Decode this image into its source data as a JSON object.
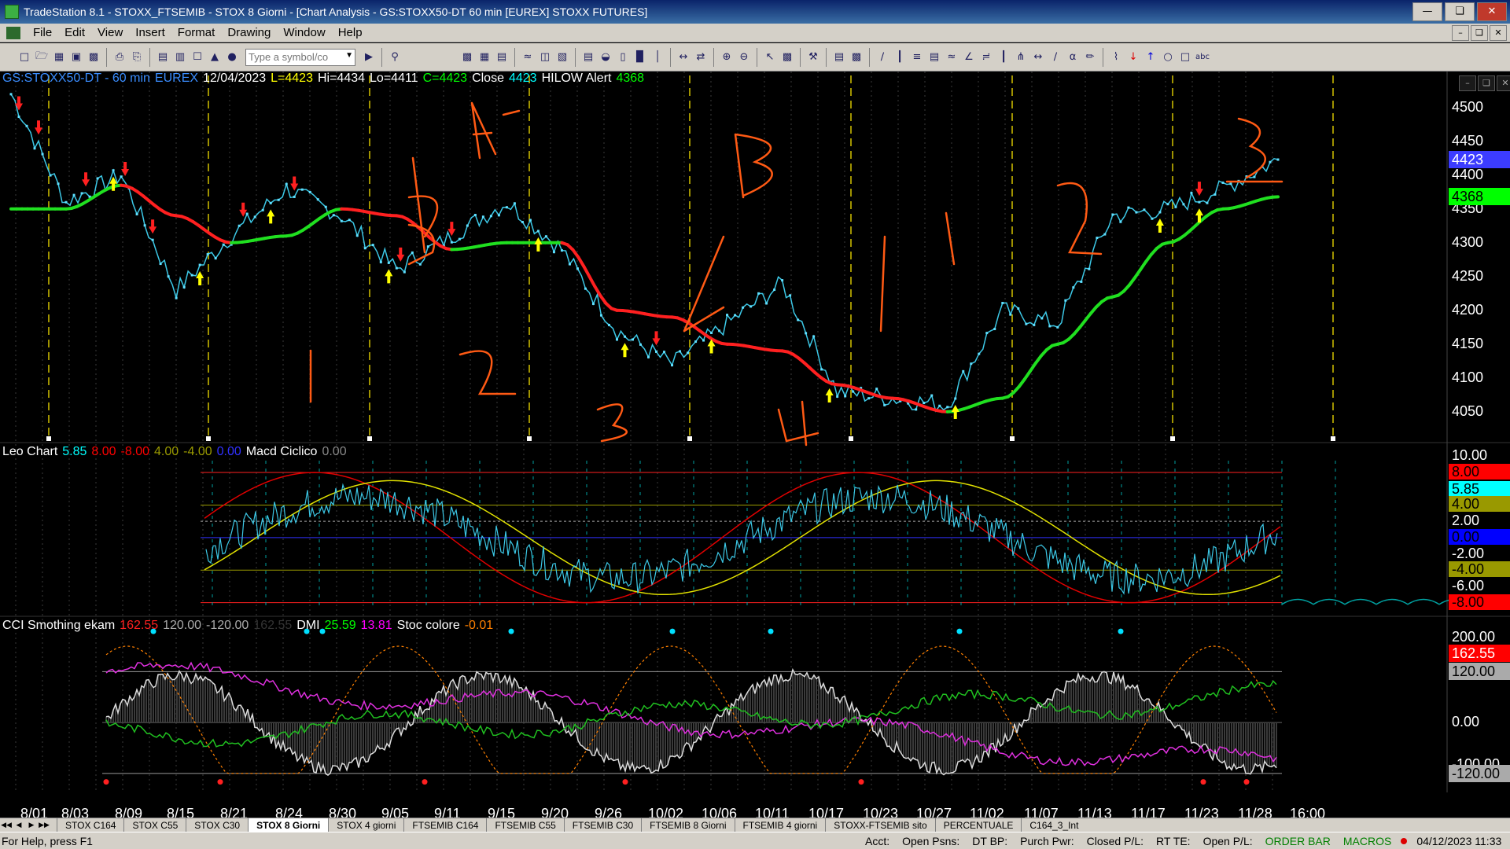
{
  "window": {
    "title": "TradeStation 8.1 - STOXX_FTSEMIB - STOX  8 Giorni - [Chart Analysis - GS:STOXX50-DT  60 min  [EUREX] STOXX FUTURES]",
    "controls": [
      "—",
      "❏",
      "✕"
    ]
  },
  "menu": {
    "items": [
      "File",
      "Edit",
      "View",
      "Insert",
      "Format",
      "Drawing",
      "Window",
      "Help"
    ]
  },
  "toolbar": {
    "symbol_placeholder": "Type a symbol/co"
  },
  "price_pane": {
    "header": [
      {
        "text": "GS:STOXX50-DT - 60 min",
        "color": "#3a8dff"
      },
      {
        "text": "EUREX",
        "color": "#3a8dff"
      },
      {
        "text": "12/04/2023",
        "color": "#ffffff"
      },
      {
        "text": "L=4423",
        "color": "#ffff00"
      },
      {
        "text": "Hi=4434",
        "color": "#ffffff"
      },
      {
        "text": "Lo=4411",
        "color": "#ffffff"
      },
      {
        "text": "C=4423",
        "color": "#00ff00"
      },
      {
        "text": "Close",
        "color": "#ffffff"
      },
      {
        "text": "4423",
        "color": "#00ffff"
      },
      {
        "text": "HILOW Alert",
        "color": "#ffffff"
      },
      {
        "text": "4368",
        "color": "#00ff00"
      }
    ],
    "y_ticks": [
      "4500",
      "4450",
      "4400",
      "4350",
      "4300",
      "4250",
      "4200",
      "4150",
      "4100",
      "4050"
    ],
    "badges": [
      {
        "text": "4423",
        "bg": "#3c3cff",
        "fg": "#ffffff"
      },
      {
        "text": "4368",
        "bg": "#00ff00",
        "fg": "#000000"
      }
    ],
    "annotations": [
      "A",
      "B",
      "1",
      "2",
      "3",
      "4",
      "1",
      "2",
      "3",
      "4",
      "1",
      "2",
      "3"
    ]
  },
  "leo_pane": {
    "header": [
      {
        "text": "Leo Chart",
        "color": "#ffffff"
      },
      {
        "text": "5.85",
        "color": "#00ffff"
      },
      {
        "text": "8.00",
        "color": "#ff0000"
      },
      {
        "text": "-8.00",
        "color": "#ff0000"
      },
      {
        "text": "4.00",
        "color": "#999900"
      },
      {
        "text": "-4.00",
        "color": "#999900"
      },
      {
        "text": "0.00",
        "color": "#3030ff"
      },
      {
        "text": "Macd Ciclico",
        "color": "#ffffff"
      },
      {
        "text": "0.00",
        "color": "#888888"
      }
    ],
    "y_ticks": [
      "10.00",
      "2.00",
      "-2.00",
      "-6.00"
    ],
    "badges": [
      {
        "text": "8.00",
        "bg": "#ff0000",
        "fg": "#000000"
      },
      {
        "text": "5.85",
        "bg": "#00ffff",
        "fg": "#000000"
      },
      {
        "text": "4.00",
        "bg": "#999900",
        "fg": "#000000"
      },
      {
        "text": "0.00",
        "bg": "#0000ff",
        "fg": "#000000"
      },
      {
        "text": "-4.00",
        "bg": "#999900",
        "fg": "#000000"
      },
      {
        "text": "-8.00",
        "bg": "#ff0000",
        "fg": "#000000"
      }
    ]
  },
  "cci_pane": {
    "header": [
      {
        "text": "CCI Smothing ekam",
        "color": "#ffffff"
      },
      {
        "text": "162.55",
        "color": "#ff2020"
      },
      {
        "text": "120.00",
        "color": "#aaaaaa"
      },
      {
        "text": "-120.00",
        "color": "#aaaaaa"
      },
      {
        "text": "162.55",
        "color": "#333333"
      },
      {
        "text": "DMI",
        "color": "#ffffff"
      },
      {
        "text": "25.59",
        "color": "#00ff00"
      },
      {
        "text": "13.81",
        "color": "#ff00ff"
      },
      {
        "text": "Stoc colore",
        "color": "#ffffff"
      },
      {
        "text": "-0.01",
        "color": "#ff8000"
      }
    ],
    "y_ticks": [
      "200.00",
      "0.00",
      "-100.00"
    ],
    "badges": [
      {
        "text": "162.55",
        "bg": "#ff0000",
        "fg": "#ffffff"
      },
      {
        "text": "120.00",
        "bg": "#aaaaaa",
        "fg": "#000000"
      },
      {
        "text": "-120.00",
        "bg": "#aaaaaa",
        "fg": "#000000"
      }
    ]
  },
  "x_axis": {
    "labels": [
      "8/01",
      "8/03",
      "8/09",
      "8/15",
      "8/21",
      "8/24",
      "8/30",
      "9/05",
      "9/11",
      "9/15",
      "9/20",
      "9/26",
      "10/02",
      "10/06",
      "10/11",
      "10/17",
      "10/23",
      "10/27",
      "11/02",
      "11/07",
      "11/13",
      "11/17",
      "11/23",
      "11/28",
      "16:00"
    ]
  },
  "tabs": {
    "items": [
      "STOX C164",
      "STOX C55",
      "STOX C30",
      "STOX  8 Giorni",
      "STOX 4 giorni",
      "FTSEMIB C164",
      "FTSEMIB C55",
      "FTSEMIB C30",
      "FTSEMIB  8 Giorni",
      "FTSEMIB  4 giorni",
      "STOXX-FTSEMIB sito",
      "PERCENTUALE",
      "C164_3_Int"
    ],
    "active_index": 3
  },
  "status": {
    "help": "For Help, press F1",
    "fields": [
      "Acct:",
      "Open Psns:",
      "DT BP:",
      "Purch Pwr:",
      "Closed P/L:",
      "RT TE:",
      "Open P/L:"
    ],
    "order_bar": "ORDER BAR",
    "macros": "MACROS",
    "datetime": "04/12/2023 11:33"
  },
  "chart_data": {
    "type": "line",
    "title": "GS:STOXX50-DT - 60 min",
    "x": [
      "8/01",
      "8/03",
      "8/09",
      "8/15",
      "8/21",
      "8/24",
      "8/30",
      "9/05",
      "9/11",
      "9/15",
      "9/20",
      "9/26",
      "10/02",
      "10/06",
      "10/11",
      "10/17",
      "10/23",
      "10/27",
      "11/02",
      "11/07",
      "11/13",
      "11/17",
      "11/23",
      "11/28"
    ],
    "series": [
      {
        "name": "Close",
        "values": [
          4520,
          4360,
          4400,
          4230,
          4310,
          4380,
          4340,
          4260,
          4310,
          4360,
          4290,
          4170,
          4120,
          4180,
          4240,
          4080,
          4070,
          4060,
          4200,
          4180,
          4340,
          4350,
          4380,
          4423
        ]
      },
      {
        "name": "HILOW Alert",
        "values": [
          4350,
          4350,
          4385,
          4340,
          4300,
          4310,
          4350,
          4340,
          4290,
          4300,
          4300,
          4200,
          4190,
          4150,
          4140,
          4090,
          4070,
          4050,
          4070,
          4150,
          4220,
          4300,
          4350,
          4368
        ]
      }
    ],
    "ylim": [
      4030,
      4530
    ]
  }
}
